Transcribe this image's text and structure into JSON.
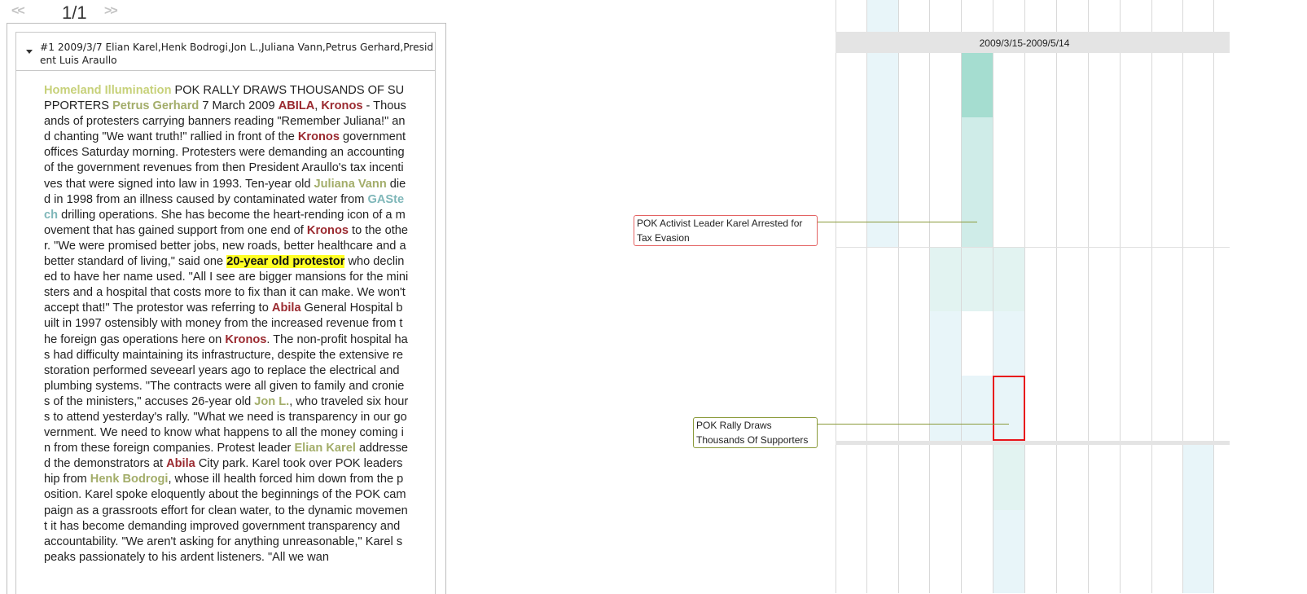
{
  "pager": {
    "prev_label": "<<",
    "page_indicator": "1/1",
    "next_label": ">>"
  },
  "document": {
    "header": "#1 2009/3/7 Elian Karel,Henk Bodrogi,Jon L.,Juliana Vann,Petrus Gerhard,President Luis Araullo",
    "segments": [
      {
        "text": "Homeland Illumination",
        "type": "org"
      },
      {
        "text": " POK RALLY DRAWS THOUSANDS OF SUPPORTERS ",
        "type": "text"
      },
      {
        "text": "Petrus Gerhard",
        "type": "person"
      },
      {
        "text": " 7 March 2009 ",
        "type": "text"
      },
      {
        "text": "ABILA",
        "type": "loc"
      },
      {
        "text": ", ",
        "type": "text"
      },
      {
        "text": "Kronos",
        "type": "loc"
      },
      {
        "text": " - Thousands of protesters carrying banners reading \"Remember Juliana!\" and chanting \"We want truth!\" rallied in front of the ",
        "type": "text"
      },
      {
        "text": "Kronos",
        "type": "loc"
      },
      {
        "text": " government offices Saturday morning. Protesters were demanding an accounting of the government revenues from then President Araullo's tax incentives that were signed into law in 1993. Ten-year old ",
        "type": "text"
      },
      {
        "text": "Juliana Vann",
        "type": "person"
      },
      {
        "text": " died in 1998 from an illness caused by contaminated water from ",
        "type": "text"
      },
      {
        "text": "GAStech",
        "type": "company"
      },
      {
        "text": " drilling operations. She has become the heart-rending icon of a movement that has gained support from one end of ",
        "type": "text"
      },
      {
        "text": "Kronos",
        "type": "loc"
      },
      {
        "text": " to the other. \"We were promised better jobs, new roads, better healthcare and a better standard of living,\" said one ",
        "type": "text"
      },
      {
        "text": "20-year old protestor",
        "type": "highlight"
      },
      {
        "text": " who declined to have her name used. \"All I see are bigger mansions for the ministers and a hospital that costs more to fix than it can make. We won't accept that!\" The protestor was referring to ",
        "type": "text"
      },
      {
        "text": "Abila",
        "type": "loc"
      },
      {
        "text": " General Hospital built in 1997 ostensibly with money from the increased revenue from the foreign gas operations here on ",
        "type": "text"
      },
      {
        "text": "Kronos",
        "type": "loc"
      },
      {
        "text": ". The non-profit hospital has had difficulty maintaining its infrastructure, despite the extensive restoration performed seveearl years ago to replace the electrical and plumbing systems. \"The contracts were all given to family and cronies of the ministers,\" accuses 26-year old ",
        "type": "text"
      },
      {
        "text": "Jon L.",
        "type": "person"
      },
      {
        "text": ", who traveled six hours to attend yesterday's rally. \"What we need is transparency in our government. We need to know what happens to all the money coming in from these foreign companies. Protest leader ",
        "type": "text"
      },
      {
        "text": "Elian Karel",
        "type": "person"
      },
      {
        "text": " addressed the demonstrators at ",
        "type": "text"
      },
      {
        "text": "Abila",
        "type": "loc"
      },
      {
        "text": " City park. Karel took over POK leadership from ",
        "type": "text"
      },
      {
        "text": "Henk Bodrogi",
        "type": "person"
      },
      {
        "text": ", whose ill health forced him down from the position. Karel spoke eloquently about the beginnings of the POK campaign as a grassroots effort for clean water, to the dynamic movement it has become demanding improved government transparency and accountability. \"We aren't asking for anything unreasonable,\" Karel speaks passionately to his ardent listeners. \"All we wan",
        "type": "text"
      }
    ]
  },
  "timeline": {
    "period_label": "2009/3/15-2009/5/14",
    "columns": 12,
    "colors": {
      "light_blue": "#e8f5f9",
      "light_teal": "#e2f3f1",
      "mid_teal": "#cfece8",
      "deep_teal": "#a5ddd0",
      "grid": "#d9d9d9",
      "band": "#e4e4e4",
      "selection": "#e8141b"
    },
    "heat_cells": [
      {
        "col": 1,
        "rows": [
          0,
          1,
          2,
          3
        ],
        "shade": "light_blue"
      },
      {
        "col": 4,
        "rows": [
          1
        ],
        "shade": "light_teal"
      },
      {
        "col": 1,
        "rows": [
          4,
          5,
          6
        ],
        "shade": "light_blue"
      },
      {
        "col": 4,
        "rows": [
          4
        ],
        "shade": "deep_teal"
      },
      {
        "col": 4,
        "rows": [
          5,
          6
        ],
        "shade": "mid_teal"
      },
      {
        "col": 3,
        "rows": [
          7,
          8
        ],
        "shade": "light_teal"
      },
      {
        "col": 4,
        "rows": [
          7,
          8
        ],
        "shade": "light_teal"
      },
      {
        "col": 5,
        "rows": [
          7,
          8
        ],
        "shade": "light_teal"
      },
      {
        "col": 3,
        "rows": [
          9,
          10,
          11,
          12
        ],
        "shade": "light_blue"
      },
      {
        "col": 5,
        "rows": [
          9,
          10
        ],
        "shade": "light_blue"
      },
      {
        "col": 4,
        "rows": [
          11,
          12
        ],
        "shade": "light_blue"
      },
      {
        "col": 5,
        "rows": [
          11,
          12
        ],
        "shade": "light_blue"
      },
      {
        "col": 5,
        "rows": [
          13,
          14
        ],
        "shade": "light_teal"
      },
      {
        "col": 5,
        "rows": [
          15,
          16
        ],
        "shade": "light_blue"
      },
      {
        "col": 11,
        "rows": [
          13,
          14,
          15,
          16
        ],
        "shade": "light_blue"
      }
    ],
    "events": [
      {
        "label": "POK Activist Leader Karel Arrested for Tax Evasion",
        "status": "red"
      },
      {
        "label": "POK Rally Draws Thousands Of Supporters",
        "status": "olive"
      }
    ]
  }
}
